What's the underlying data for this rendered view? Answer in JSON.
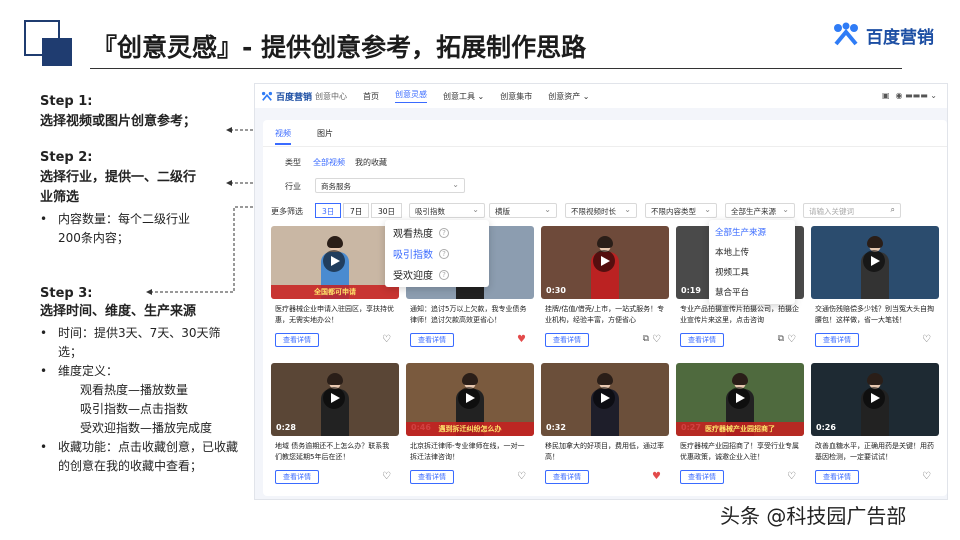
{
  "slide": {
    "title": "『创意灵感』- 提供创意参考，拓展制作思路",
    "brand": "百度营销",
    "watermark": "头条 @科技园广告部"
  },
  "steps": {
    "s1_title": "Step 1:",
    "s1_desc": "选择视频或图片创意参考；",
    "s2_title": "Step 2:",
    "s2_desc": "选择行业，提供一、二级行业筛选",
    "s2_b1": "内容数量：每个二级行业200条内容；",
    "s3_title": "Step 3:",
    "s3_desc": "选择时间、维度、生产来源",
    "s3_b1": "时间：提供3天、7天、30天筛选；",
    "s3_b2": "维度定义：",
    "s3_b2a": "观看热度—播放数量",
    "s3_b2b": "吸引指数—点击指数",
    "s3_b2c": "受欢迎指数—播放完成度",
    "s3_b3": "收藏功能：点击收藏创意，已收藏的创意在我的收藏中查看；"
  },
  "ui": {
    "brand": "百度营销",
    "sub": "创意中心",
    "nav": [
      "首页",
      "创意灵感",
      "创意工具",
      "创意集市",
      "创意资产"
    ],
    "tabs": [
      "视频",
      "图片"
    ],
    "type_label": "类型",
    "type_all": "全部视频",
    "type_fav": "我的收藏",
    "industry_label": "行业",
    "industry_value": "商务服务",
    "more_label": "更多筛选",
    "days": [
      "3日",
      "7日",
      "30日"
    ],
    "metric": "吸引指数",
    "ratio": "横版",
    "duration": "不限视频时长",
    "content_type": "不限内容类型",
    "source": "全部生产来源",
    "search_placeholder": "请输入关键词",
    "metric_options": [
      "观看热度",
      "吸引指数",
      "受欢迎度"
    ],
    "source_options": [
      "全部生产来源",
      "本地上传",
      "视频工具",
      "慧合平台"
    ],
    "detail_label": "查看详情"
  },
  "cards": [
    {
      "dur": "",
      "desc": "医疗器械企业申请入驻园区，享扶持优惠，无需实地办公！",
      "liked": false,
      "copy": false,
      "bg": "#c9b7a4",
      "shirt": "#4a8bd0",
      "banner": "全国都可申请"
    },
    {
      "dur": "",
      "desc": "通知：追讨5万以上欠款，我专业债务律师！追讨欠款高效更省心！",
      "liked": true,
      "copy": false,
      "bg": "#8c9db0",
      "shirt": "#222",
      "banner": ""
    },
    {
      "dur": "0:30",
      "desc": "挂牌/估值/借壳/上市，一站式服务！专业机构，经验丰富，方便省心",
      "liked": false,
      "copy": true,
      "bg": "#6e4a3a",
      "shirt": "#b22",
      "banner": ""
    },
    {
      "dur": "0:19",
      "desc": "专业产品拍摄宣传片拍摄公司，拍摄企业宣传片来这里，点击咨询",
      "liked": false,
      "copy": true,
      "bg": "#4a4a4a",
      "shirt": "#222",
      "banner": ""
    },
    {
      "dur": "",
      "desc": "交通伤残赔偿多少钱？别当冤大头自掏腰包！这样做，省一大笔钱！",
      "liked": false,
      "copy": false,
      "bg": "#2b4c6e",
      "shirt": "#333",
      "banner": ""
    },
    {
      "dur": "0:28",
      "desc": "地域 债务逾期还不上怎么办？联系我们教您延期5年后在还！",
      "liked": false,
      "copy": false,
      "bg": "#5a4636",
      "shirt": "#222",
      "banner": ""
    },
    {
      "dur": "0:46",
      "desc": "北京拆迁律师-专业律师在线，一对一拆迁法律咨询！",
      "liked": false,
      "copy": false,
      "bg": "#7a5a3e",
      "shirt": "#222",
      "banner": "遇到拆迁纠纷怎么办"
    },
    {
      "dur": "0:32",
      "desc": "移民加拿大的好项目，费用低，通过率高！",
      "liked": true,
      "copy": false,
      "bg": "#6b4f3a",
      "shirt": "#1e1e2a",
      "banner": ""
    },
    {
      "dur": "0:27",
      "desc": "医疗器械产业园招商了！享受行业专属优惠政策，诚邀企业入驻！",
      "liked": false,
      "copy": false,
      "bg": "#4f6a3e",
      "shirt": "#222",
      "banner": "医疗器械产业园招商了"
    },
    {
      "dur": "0:26",
      "desc": "改善血糖水平，正确用药是关键！用药基因检测，一定要试试！",
      "liked": false,
      "copy": false,
      "bg": "#1e2a33",
      "shirt": "#222",
      "banner": ""
    }
  ]
}
